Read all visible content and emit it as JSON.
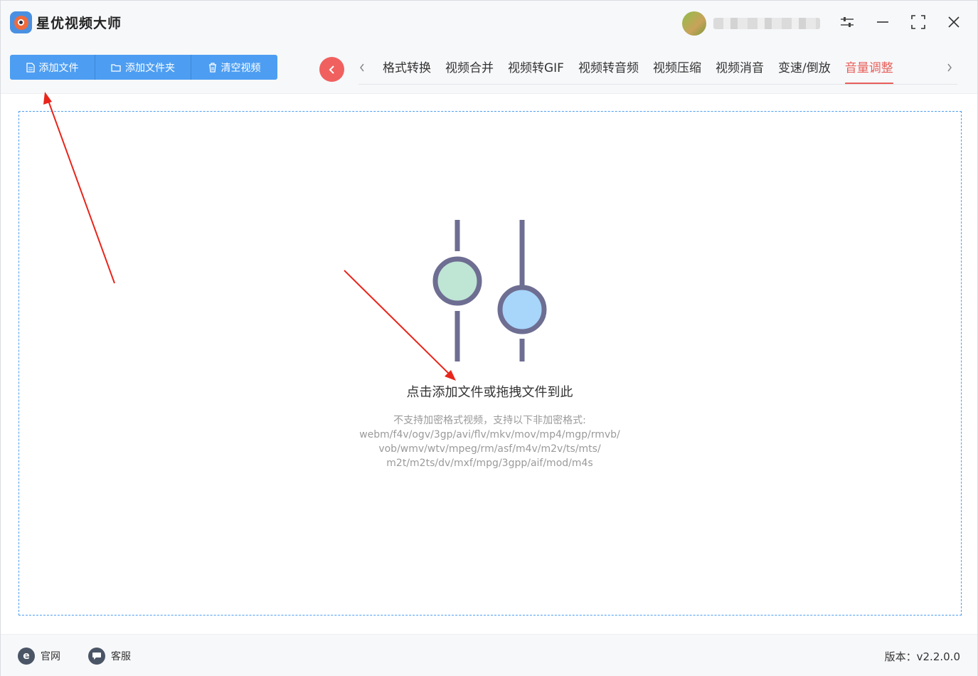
{
  "app": {
    "title": "星优视频大师"
  },
  "window_controls": {
    "settings_icon": "sliders-icon",
    "minimize_icon": "minimize-icon",
    "maximize_icon": "maximize-icon",
    "close_icon": "close-icon"
  },
  "toolbar": {
    "add_file": "添加文件",
    "add_folder": "添加文件夹",
    "clear_videos": "清空视频"
  },
  "tabs": [
    {
      "label": "格式转换",
      "active": false
    },
    {
      "label": "视频合并",
      "active": false
    },
    {
      "label": "视频转GIF",
      "active": false
    },
    {
      "label": "视频转音频",
      "active": false
    },
    {
      "label": "视频压缩",
      "active": false
    },
    {
      "label": "视频消音",
      "active": false
    },
    {
      "label": "变速/倒放",
      "active": false
    },
    {
      "label": "音量调整",
      "active": true
    }
  ],
  "dropzone": {
    "title": "点击添加文件或拖拽文件到此",
    "note_line1": "不支持加密格式视频，支持以下非加密格式:",
    "note_line2": "webm/f4v/ogv/3gp/avi/flv/mkv/mov/mp4/mgp/rmvb/",
    "note_line3": "vob/wmv/wtv/mpeg/rm/asf/m4v/m2v/ts/mts/",
    "note_line4": "m2t/m2ts/dv/mxf/mpg/3gpp/aif/mod/m4s"
  },
  "footer": {
    "website": "官网",
    "support": "客服",
    "version": "版本：v2.2.0.0"
  },
  "colors": {
    "accent_blue": "#4d9ef2",
    "accent_red": "#e8605a",
    "annotation_red": "#e8251b"
  }
}
